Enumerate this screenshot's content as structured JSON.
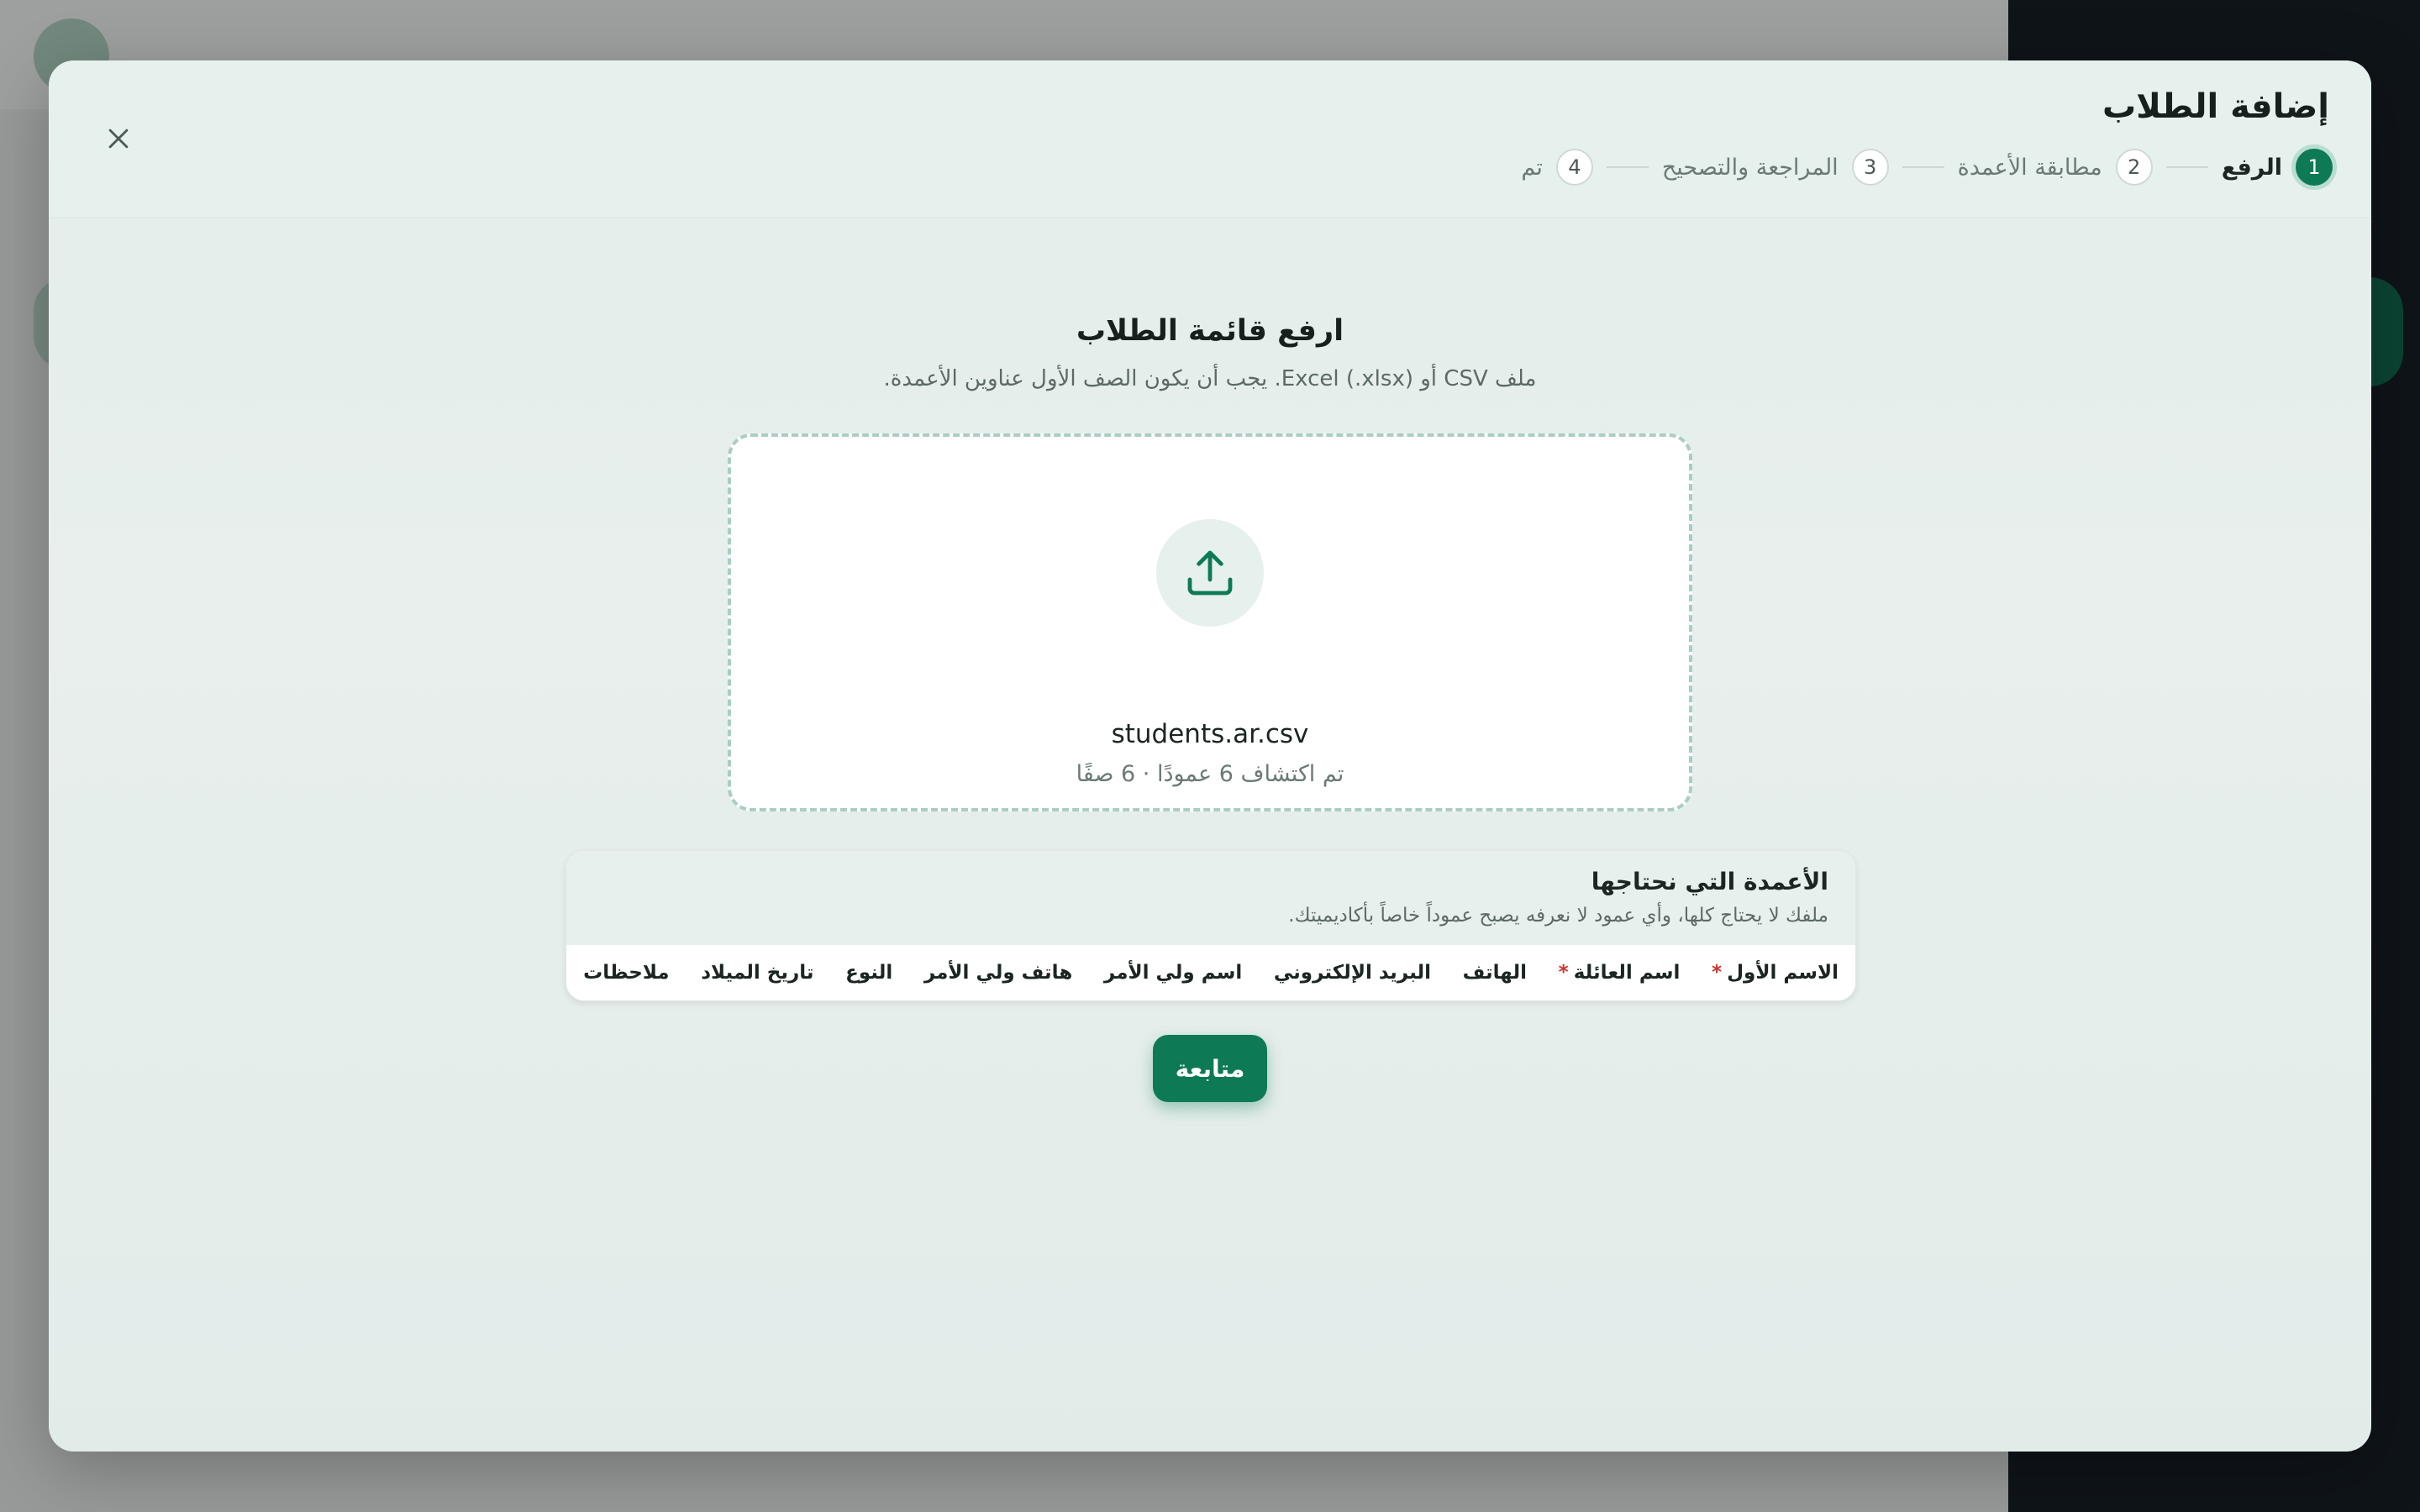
{
  "modal": {
    "title": "إضافة الطلاب",
    "close_icon": "close-icon"
  },
  "steps": [
    {
      "number": "1",
      "label": "الرفع",
      "active": true
    },
    {
      "number": "2",
      "label": "مطابقة الأعمدة",
      "active": false
    },
    {
      "number": "3",
      "label": "المراجعة والتصحيح",
      "active": false
    },
    {
      "number": "4",
      "label": "تم",
      "active": false
    }
  ],
  "upload": {
    "title": "ارفع قائمة الطلاب",
    "subtitle": "ملف CSV أو Excel (.xlsx). يجب أن يكون الصف الأول عناوين الأعمدة.",
    "icon": "upload-icon",
    "file_name": "students.ar.csv",
    "file_meta": "تم اكتشاف 6 عمودًا · 6 صفًا"
  },
  "columns": {
    "title": "الأعمدة التي نحتاجها",
    "note": "ملفك لا يحتاج كلها، وأي عمود لا نعرفه يصبح عموداً خاصاً بأكاديميتك.",
    "items": [
      {
        "label": "الاسم الأول",
        "required": "*"
      },
      {
        "label": "اسم العائلة",
        "required": "*"
      },
      {
        "label": "الهاتف"
      },
      {
        "label": "البريد الإلكتروني"
      },
      {
        "label": "اسم ولي الأمر"
      },
      {
        "label": "هاتف ولي الأمر"
      },
      {
        "label": "النوع"
      },
      {
        "label": "تاريخ الميلاد"
      },
      {
        "label": "ملاحظات"
      }
    ]
  },
  "actions": {
    "continue_label": "متابعة"
  },
  "colors": {
    "accent": "#0e7a55",
    "required": "#d0342c"
  }
}
